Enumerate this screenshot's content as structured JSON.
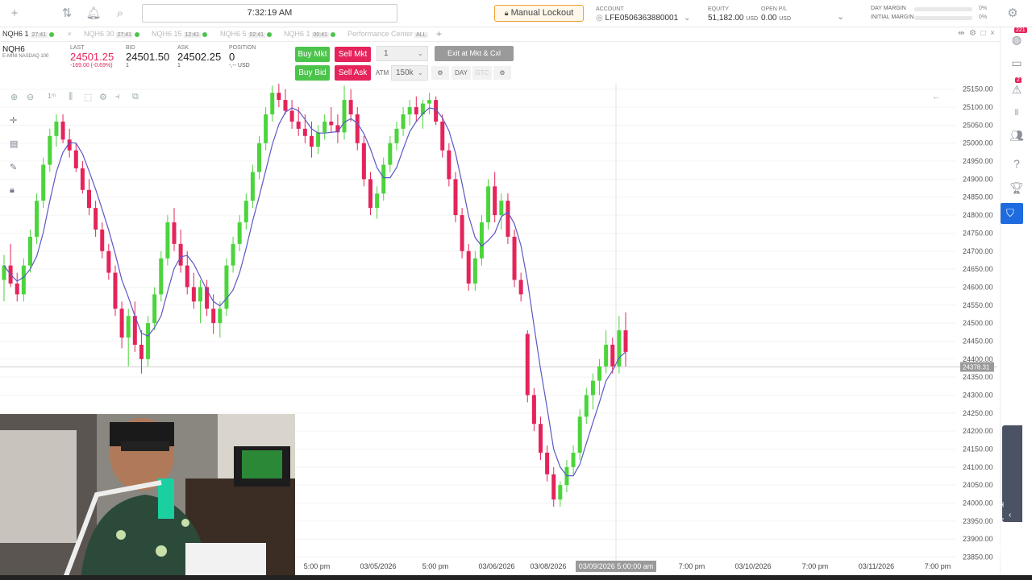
{
  "topbar": {
    "clock": "7:32:19 AM",
    "lockout_label": "Manual Lockout",
    "account_label": "ACCOUNT",
    "account_value": "LFE0506363880001",
    "equity_label": "EQUITY",
    "equity_value": "51,182.00",
    "equity_unit": "USD",
    "openpl_label": "OPEN P/L",
    "openpl_value": "0.00",
    "openpl_unit": "USD",
    "day_margin_label": "DAY MARGIN",
    "day_margin_pct": "0%",
    "initial_margin_label": "INITIAL MARGIN",
    "initial_margin_pct": "0%"
  },
  "tabs": [
    {
      "label": "NQH6 1",
      "time": "27:41"
    },
    {
      "label": "NQH6 30",
      "time": "27:41"
    },
    {
      "label": "NQH6 15",
      "time": "12:41"
    },
    {
      "label": "NQH6 5",
      "time": "02:41"
    },
    {
      "label": "NQH6 1",
      "time": "00:41"
    },
    {
      "label": "Performance Center",
      "time": "ALL"
    }
  ],
  "quote": {
    "symbol": "NQH6",
    "description": "E-MINI NASDAQ 100",
    "last_label": "LAST",
    "last": "24501.25",
    "change": "-169.00 (-0.69%)",
    "bid_label": "BID",
    "bid": "24501.50",
    "bid_size": "1",
    "ask_label": "ASK",
    "ask": "24502.25",
    "ask_size": "1",
    "position_label": "POSITION",
    "position": "0",
    "position_sub": "-,-- USD"
  },
  "order": {
    "buy_mkt": "Buy Mkt",
    "sell_mkt": "Sell Mkt",
    "buy_bid": "Buy Bid",
    "sell_ask": "Sell Ask",
    "qty": "1",
    "exit_label": "Exit at Mkt & Cxl",
    "atm_label": "ATM",
    "atm_value": "150k",
    "tif_day": "DAY",
    "tif_gtc": "GTC"
  },
  "chart_data": {
    "type": "candlestick",
    "price_labels": [
      "25150.00",
      "25100.00",
      "25050.00",
      "25000.00",
      "24950.00",
      "24900.00",
      "24850.00",
      "24800.00",
      "24750.00",
      "24700.00",
      "24650.00",
      "24600.00",
      "24550.00",
      "24500.00",
      "24450.00",
      "24400.00",
      "24350.00",
      "24300.00",
      "24250.00",
      "24200.00",
      "24150.00",
      "24100.00",
      "24050.00",
      "24000.00",
      "23950.00",
      "23900.00",
      "23850.00"
    ],
    "ylim": [
      23840,
      25165
    ],
    "current_price": "24378.31",
    "time_labels": [
      "5:00 pm",
      "03/05/2026",
      "5:00 pm",
      "03/06/2026",
      "03/08/2026",
      "7:00 pm",
      "03/10/2026",
      "7:00 pm",
      "03/11/2026",
      "7:00 pm"
    ],
    "crosshair_time": "03/09/2026 5:00:00 am",
    "ohlc": [
      [
        24620,
        24690,
        24560,
        24660
      ],
      [
        24660,
        24720,
        24600,
        24610
      ],
      [
        24610,
        24640,
        24560,
        24580
      ],
      [
        24580,
        24680,
        24560,
        24660
      ],
      [
        24660,
        24760,
        24640,
        24740
      ],
      [
        24740,
        24860,
        24720,
        24840
      ],
      [
        24840,
        24960,
        24820,
        24940
      ],
      [
        24940,
        25040,
        24920,
        25020
      ],
      [
        25020,
        25080,
        24990,
        25060
      ],
      [
        25060,
        25080,
        25000,
        25010
      ],
      [
        25010,
        25040,
        24960,
        24980
      ],
      [
        24980,
        25000,
        24920,
        24930
      ],
      [
        24930,
        24950,
        24860,
        24870
      ],
      [
        24870,
        24900,
        24800,
        24820
      ],
      [
        24820,
        24840,
        24740,
        24760
      ],
      [
        24760,
        24780,
        24680,
        24700
      ],
      [
        24700,
        24720,
        24620,
        24640
      ],
      [
        24640,
        24660,
        24520,
        24540
      ],
      [
        24540,
        24560,
        24430,
        24460
      ],
      [
        24460,
        24540,
        24380,
        24520
      ],
      [
        24520,
        24560,
        24420,
        24440
      ],
      [
        24440,
        24480,
        24360,
        24400
      ],
      [
        24400,
        24520,
        24380,
        24500
      ],
      [
        24500,
        24600,
        24480,
        24580
      ],
      [
        24580,
        24700,
        24560,
        24680
      ],
      [
        24680,
        24800,
        24660,
        24780
      ],
      [
        24780,
        24820,
        24700,
        24720
      ],
      [
        24720,
        24760,
        24640,
        24660
      ],
      [
        24660,
        24700,
        24580,
        24600
      ],
      [
        24600,
        24640,
        24540,
        24560
      ],
      [
        24560,
        24620,
        24500,
        24600
      ],
      [
        24600,
        24620,
        24520,
        24540
      ],
      [
        24540,
        24580,
        24470,
        24500
      ],
      [
        24500,
        24560,
        24460,
        24540
      ],
      [
        24540,
        24680,
        24520,
        24660
      ],
      [
        24660,
        24740,
        24640,
        24720
      ],
      [
        24720,
        24800,
        24700,
        24780
      ],
      [
        24780,
        24860,
        24760,
        24840
      ],
      [
        24840,
        24940,
        24820,
        24920
      ],
      [
        24920,
        25020,
        24900,
        25000
      ],
      [
        25000,
        25100,
        24980,
        25080
      ],
      [
        25080,
        25160,
        25060,
        25140
      ],
      [
        25140,
        25170,
        25100,
        25120
      ],
      [
        25120,
        25150,
        25080,
        25090
      ],
      [
        25090,
        25120,
        25040,
        25060
      ],
      [
        25060,
        25100,
        25020,
        25040
      ],
      [
        25040,
        25080,
        25000,
        25020
      ],
      [
        25020,
        25060,
        24960,
        24990
      ],
      [
        24990,
        25050,
        24970,
        25030
      ],
      [
        25030,
        25080,
        25010,
        25060
      ],
      [
        25060,
        25100,
        25030,
        25050
      ],
      [
        25050,
        25080,
        25000,
        25030
      ],
      [
        25030,
        25160,
        25010,
        25120
      ],
      [
        25120,
        25150,
        25060,
        25080
      ],
      [
        25080,
        25100,
        24980,
        25000
      ],
      [
        25000,
        25020,
        24880,
        24900
      ],
      [
        24900,
        24920,
        24800,
        24820
      ],
      [
        24820,
        24880,
        24790,
        24860
      ],
      [
        24860,
        24960,
        24840,
        24940
      ],
      [
        24940,
        25020,
        24920,
        25000
      ],
      [
        25000,
        25060,
        24980,
        25040
      ],
      [
        25040,
        25100,
        25020,
        25080
      ],
      [
        25080,
        25120,
        25050,
        25100
      ],
      [
        25100,
        25130,
        25060,
        25080
      ],
      [
        25080,
        25120,
        25040,
        25110
      ],
      [
        25110,
        25140,
        25080,
        25120
      ],
      [
        25120,
        25130,
        25050,
        25060
      ],
      [
        25060,
        25080,
        24960,
        24980
      ],
      [
        24980,
        25000,
        24880,
        24900
      ],
      [
        24900,
        24920,
        24780,
        24800
      ],
      [
        24800,
        24820,
        24680,
        24700
      ],
      [
        24700,
        24720,
        24590,
        24610
      ],
      [
        24610,
        24700,
        24590,
        24680
      ],
      [
        24680,
        24800,
        24660,
        24780
      ],
      [
        24780,
        24900,
        24760,
        24880
      ],
      [
        24880,
        24920,
        24780,
        24800
      ],
      [
        24800,
        24860,
        24760,
        24840
      ],
      [
        24840,
        24860,
        24720,
        24740
      ],
      [
        24740,
        24760,
        24600,
        24620
      ],
      [
        24620,
        24640,
        24560,
        24580
      ],
      [
        24470,
        24480,
        24280,
        24300
      ],
      [
        24300,
        24320,
        24200,
        24220
      ],
      [
        24220,
        24240,
        24120,
        24140
      ],
      [
        24140,
        24160,
        24060,
        24080
      ],
      [
        24080,
        24100,
        23990,
        24010
      ],
      [
        24010,
        24060,
        23990,
        24050
      ],
      [
        24050,
        24120,
        24030,
        24100
      ],
      [
        24100,
        24160,
        24080,
        24140
      ],
      [
        24140,
        24260,
        24120,
        24240
      ],
      [
        24240,
        24320,
        24220,
        24300
      ],
      [
        24300,
        24360,
        24260,
        24340
      ],
      [
        24340,
        24400,
        24300,
        24380
      ],
      [
        24380,
        24480,
        24360,
        24440
      ],
      [
        24440,
        24460,
        24360,
        24380
      ],
      [
        24380,
        24520,
        24360,
        24480
      ],
      [
        24480,
        24530,
        24380,
        24420
      ]
    ]
  },
  "webcam": {},
  "rightbar": {
    "badge_top": "221",
    "badge_alert": "2",
    "help_label": "Tradovate Help"
  }
}
